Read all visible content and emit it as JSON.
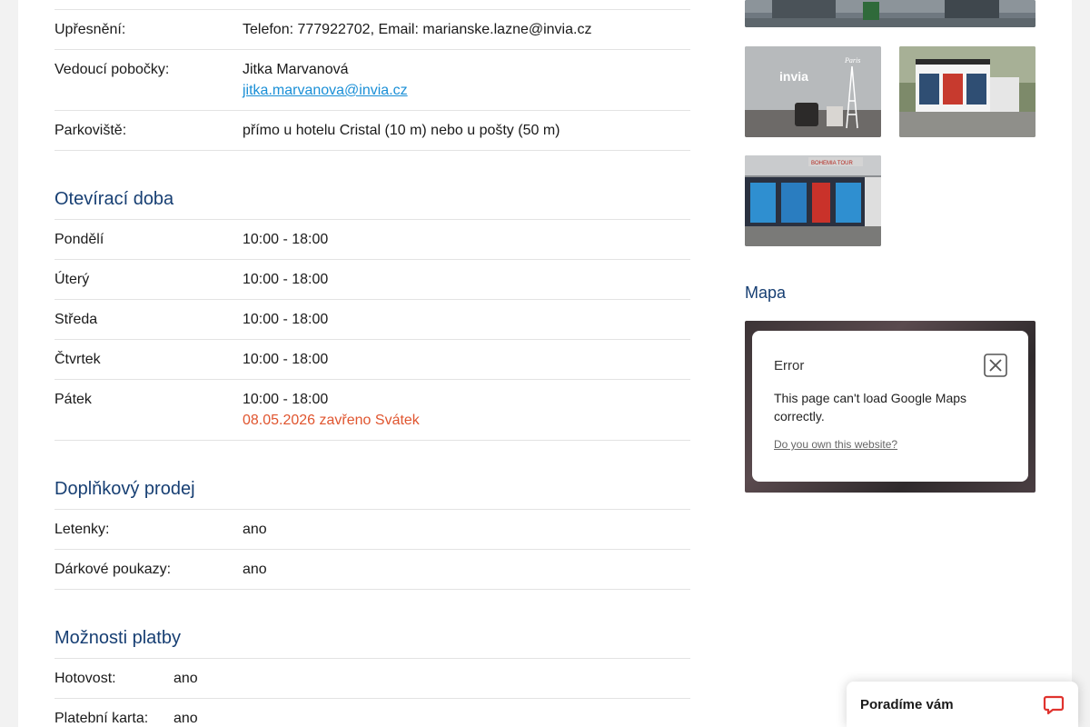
{
  "contact": {
    "upresneni_label": "Upřesnění:",
    "upresneni_value": "Telefon: 777922702, Email: marianske.lazne@invia.cz",
    "vedouci_label": "Vedoucí pobočky:",
    "vedouci_name": "Jitka Marvanová",
    "vedouci_email": "jitka.marvanova@invia.cz",
    "parkoviste_label": "Parkoviště:",
    "parkoviste_value": "přímo u hotelu Cristal (10 m) nebo u pošty (50 m)"
  },
  "hours": {
    "title": "Otevírací doba",
    "rows": [
      {
        "day": "Pondělí",
        "time": "10:00 - 18:00"
      },
      {
        "day": "Úterý",
        "time": "10:00 - 18:00"
      },
      {
        "day": "Středa",
        "time": "10:00 - 18:00"
      },
      {
        "day": "Čtvrtek",
        "time": "10:00 - 18:00"
      },
      {
        "day": "Pátek",
        "time": "10:00 - 18:00",
        "note": "08.05.2026 zavřeno Svátek"
      }
    ]
  },
  "extra": {
    "title": "Doplňkový prodej",
    "rows": [
      {
        "label": "Letenky:",
        "value": "ano"
      },
      {
        "label": "Dárkové poukazy:",
        "value": "ano"
      }
    ]
  },
  "payment": {
    "title": "Možnosti platby",
    "rows": [
      {
        "label": "Hotovost:",
        "value": "ano"
      },
      {
        "label": "Platební karta:",
        "value": "ano"
      }
    ]
  },
  "photos": {
    "logo_text": "invia",
    "paris_text": "Paris",
    "sign_text": "BOHEMIA TOUR"
  },
  "map": {
    "title": "Mapa",
    "error_title": "Error",
    "error_message": "This page can't load Google Maps correctly.",
    "error_link": "Do you own this website?"
  },
  "chat": {
    "label": "Poradíme vám"
  },
  "colors": {
    "heading": "#173f73",
    "link": "#1a8fd6",
    "holiday": "#e0552f",
    "chat_icon": "#e0332e"
  }
}
